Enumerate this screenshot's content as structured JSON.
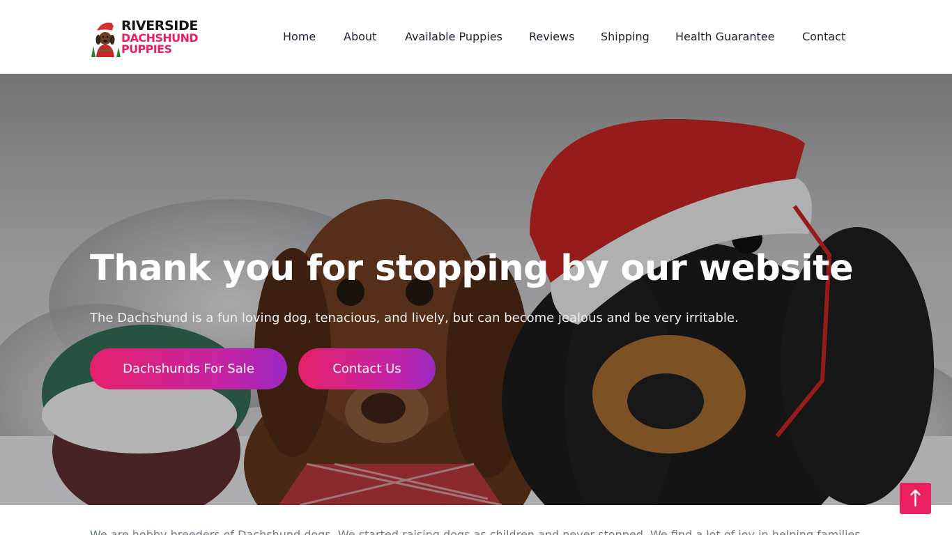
{
  "logo": {
    "line1": "RIVERSIDE",
    "line2": "DACHSHUND",
    "line3": "PUPPIES",
    "icon": "dachshund-santa-logo-icon"
  },
  "nav": {
    "items": [
      {
        "label": "Home"
      },
      {
        "label": "About"
      },
      {
        "label": "Available Puppies"
      },
      {
        "label": "Reviews"
      },
      {
        "label": "Shipping"
      },
      {
        "label": "Health Guarantee"
      },
      {
        "label": "Contact"
      }
    ]
  },
  "hero": {
    "title": "Thank you for stopping by our website",
    "subtitle": "The Dachshund is a fun loving dog, tenacious, and lively, but can become jealous and be very irritable.",
    "primary_button": "Dachshunds For Sale",
    "secondary_button": "Contact Us",
    "background": "two-dachshunds-christmas-photo"
  },
  "intro": {
    "text": "We are hobby breeders of Dachshund dogs. We started raising dogs as children and never stopped. We find a lot of joy in helping families"
  },
  "scroll_top": {
    "icon": "arrow-up-icon"
  },
  "colors": {
    "accent": "#ea1f5f",
    "gradient_start": "#e5206a",
    "gradient_end": "#9b28c2",
    "nav_text": "#1a2233",
    "body_text": "#6e7891"
  }
}
